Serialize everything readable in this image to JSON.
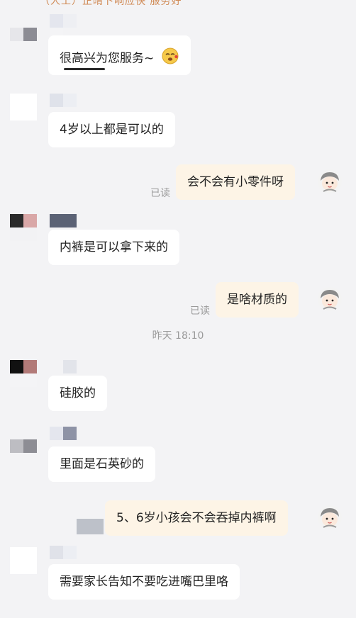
{
  "header_partial": "（人工）正晴卜响应快 服务好",
  "messages": [
    {
      "side": "in",
      "text": "很高兴为您服务~"
    },
    {
      "side": "in",
      "text": "4岁以上都是可以的"
    },
    {
      "side": "out",
      "text": "会不会有小零件呀",
      "status": "已读"
    },
    {
      "side": "in",
      "text": "内裤是可以拿下来的"
    },
    {
      "side": "out",
      "text": "是啥材质的",
      "status": "已读"
    },
    {
      "side": "in",
      "text": "硅胶的"
    },
    {
      "side": "in",
      "text": "里面是石英砂的"
    },
    {
      "side": "out",
      "text": "5、6岁小孩会不会吞掉内裤啊"
    },
    {
      "side": "in",
      "text": "需要家长告知不要吃进嘴巴里咯"
    }
  ],
  "timestamp": "昨天  18:10",
  "icons": {
    "emoji": "sleepy-face-emoji-icon",
    "user_avatar": "cartoon-user-avatar-icon",
    "agent_avatar": "pixelated-agent-avatar-icon"
  },
  "colors": {
    "background": "#f3f3f5",
    "incoming_bubble": "#ffffff",
    "outgoing_bubble": "#fdf4e6",
    "read_status": "#9a9a9a"
  }
}
